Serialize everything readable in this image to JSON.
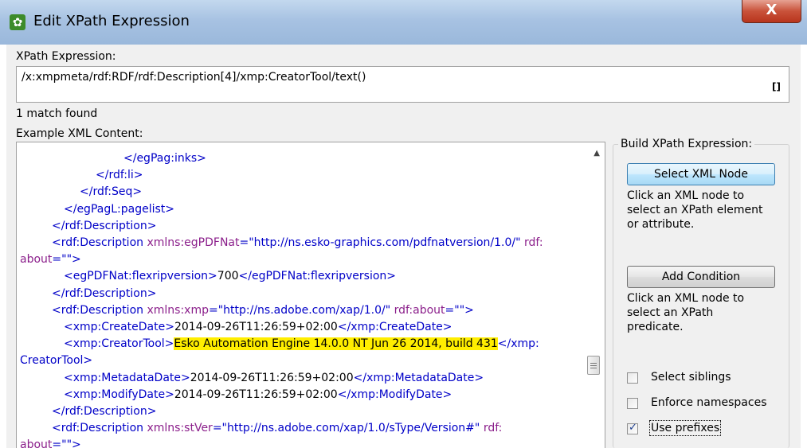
{
  "window": {
    "title": "Edit XPath Expression",
    "close_label": "X"
  },
  "xpath": {
    "label": "XPath Expression:",
    "value": "/x:xmpmeta/rdf:RDF/rdf:Description[4]/xmp:CreatorTool/text()",
    "brackets": "[]"
  },
  "status": {
    "match_text": "1 match found"
  },
  "xml": {
    "label": "Example XML Content:",
    "lines": [
      {
        "s": [
          {
            "c": "tag",
            "t": "</egPag:inks>"
          }
        ]
      },
      {
        "s": [
          {
            "c": "tag",
            "t": "</rdf:li>"
          }
        ]
      },
      {
        "s": [
          {
            "c": "tag",
            "t": "</rdf:Seq>"
          }
        ]
      },
      {
        "s": [
          {
            "c": "tag",
            "t": "</egPagL:pagelist>"
          }
        ]
      },
      {
        "s": [
          {
            "c": "tag",
            "t": "</rdf:Description>"
          }
        ]
      },
      {
        "s": [
          {
            "c": "tag",
            "t": "<rdf:Description "
          },
          {
            "c": "attr",
            "t": "xmlns:egPDFNat"
          },
          {
            "c": "tag",
            "t": "=\"http://ns.esko-graphics.com/pdfnatversion/1.0/\" "
          },
          {
            "c": "attr",
            "t": "rdf:"
          }
        ]
      },
      {
        "s": [
          {
            "c": "attr",
            "t": "about"
          },
          {
            "c": "tag",
            "t": "=\"\">"
          }
        ]
      },
      {
        "s": [
          {
            "c": "tag",
            "t": "<egPDFNat:flexripversion>"
          },
          {
            "c": "txt",
            "t": "700"
          },
          {
            "c": "tag",
            "t": "</egPDFNat:flexripversion>"
          }
        ]
      },
      {
        "s": [
          {
            "c": "tag",
            "t": "</rdf:Description>"
          }
        ]
      },
      {
        "s": [
          {
            "c": "tag",
            "t": "<rdf:Description "
          },
          {
            "c": "attr",
            "t": "xmlns:xmp"
          },
          {
            "c": "tag",
            "t": "=\"http://ns.adobe.com/xap/1.0/\" "
          },
          {
            "c": "attr",
            "t": "rdf:about"
          },
          {
            "c": "tag",
            "t": "=\"\">"
          }
        ]
      },
      {
        "s": [
          {
            "c": "tag",
            "t": "<xmp:CreateDate>"
          },
          {
            "c": "txt",
            "t": "2014-09-26T11:26:59+02:00"
          },
          {
            "c": "tag",
            "t": "</xmp:CreateDate>"
          }
        ]
      },
      {
        "s": [
          {
            "c": "tag",
            "t": "<xmp:CreatorTool>"
          },
          {
            "c": "hl",
            "t": "Esko Automation Engine 14.0.0 NT Jun 26 2014, build 431"
          },
          {
            "c": "tag",
            "t": "</xmp:"
          }
        ]
      },
      {
        "s": [
          {
            "c": "tag",
            "t": "CreatorTool>"
          }
        ]
      },
      {
        "s": [
          {
            "c": "tag",
            "t": "<xmp:MetadataDate>"
          },
          {
            "c": "txt",
            "t": "2014-09-26T11:26:59+02:00"
          },
          {
            "c": "tag",
            "t": "</xmp:MetadataDate>"
          }
        ]
      },
      {
        "s": [
          {
            "c": "tag",
            "t": "<xmp:ModifyDate>"
          },
          {
            "c": "txt",
            "t": "2014-09-26T11:26:59+02:00"
          },
          {
            "c": "tag",
            "t": "</xmp:ModifyDate>"
          }
        ]
      },
      {
        "s": [
          {
            "c": "tag",
            "t": "</rdf:Description>"
          }
        ]
      },
      {
        "s": [
          {
            "c": "tag",
            "t": "<rdf:Description "
          },
          {
            "c": "attr",
            "t": "xmlns:stVer"
          },
          {
            "c": "tag",
            "t": "=\"http://ns.adobe.com/xap/1.0/sType/Version#\" "
          },
          {
            "c": "attr",
            "t": "rdf:"
          }
        ]
      },
      {
        "s": [
          {
            "c": "attr",
            "t": "about"
          },
          {
            "c": "tag",
            "t": "=\"\">"
          }
        ]
      }
    ]
  },
  "builder": {
    "title": "Build XPath Expression:",
    "select_node_label": "Select XML Node",
    "select_node_help": [
      "Click an XML node to",
      "select an XPath element",
      "or attribute."
    ],
    "add_condition_label": "Add Condition",
    "add_condition_help": [
      "Click an XML node to",
      "select an XPath",
      "predicate."
    ],
    "checkboxes": [
      {
        "label": "Select siblings",
        "checked": false
      },
      {
        "label": "Enforce namespaces",
        "checked": false
      },
      {
        "label": "Use prefixes",
        "checked": true
      }
    ]
  },
  "colors": {
    "tag": "#0000c8",
    "attr": "#8b1f8b",
    "highlight": "#ffee00"
  }
}
